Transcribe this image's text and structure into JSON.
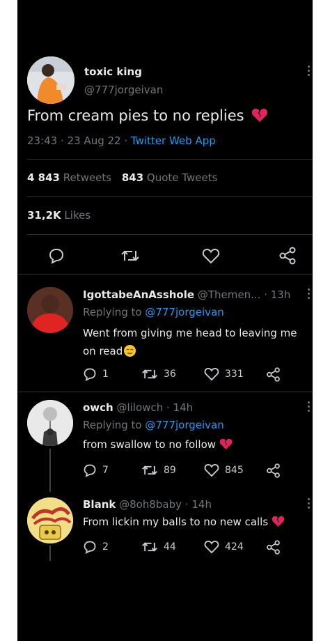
{
  "main_tweet": {
    "display_name": "toxic king",
    "handle": "@777jorgeivan",
    "text": "From cream pies to no replies",
    "emoji": "broken-heart-emoji",
    "time": "23:43",
    "date": "23 Aug 22",
    "source": "Twitter Web App",
    "retweets_count": "4 843",
    "retweets_label": "Retweets",
    "quotes_count": "843",
    "quotes_label": "Quote Tweets",
    "likes_count": "31,2K",
    "likes_label": "Likes",
    "sep": "·"
  },
  "replies": [
    {
      "display_name": "IgottabeAnAsshole",
      "handle": "@Themen...",
      "time": "13h",
      "replying_label": "Replying to",
      "replying_handle": "@777jorgeivan",
      "text_line1": "Went from giving me head to leaving me",
      "text_line2": "on read",
      "emoji": "relieved-face-emoji",
      "replies_count": "1",
      "retweets_count": "36",
      "likes_count": "331"
    },
    {
      "display_name": "owch",
      "handle": "@lilowch",
      "time": "14h",
      "replying_label": "Replying to",
      "replying_handle": "@777jorgeivan",
      "text": "from swallow to no follow",
      "emoji": "broken-heart-emoji",
      "replies_count": "7",
      "retweets_count": "89",
      "likes_count": "845"
    },
    {
      "display_name": "Blank",
      "handle": "@8oh8baby",
      "time": "14h",
      "text": "From lickin my balls to no new calls",
      "emoji": "broken-heart-emoji",
      "replies_count": "2",
      "retweets_count": "44",
      "likes_count": "424"
    }
  ],
  "colors": {
    "background": "#000000",
    "text": "#e7e9ea",
    "muted": "#71767b",
    "link": "#1d9bf0",
    "divider": "#2f3336",
    "heart_emoji": "#e0245e"
  }
}
